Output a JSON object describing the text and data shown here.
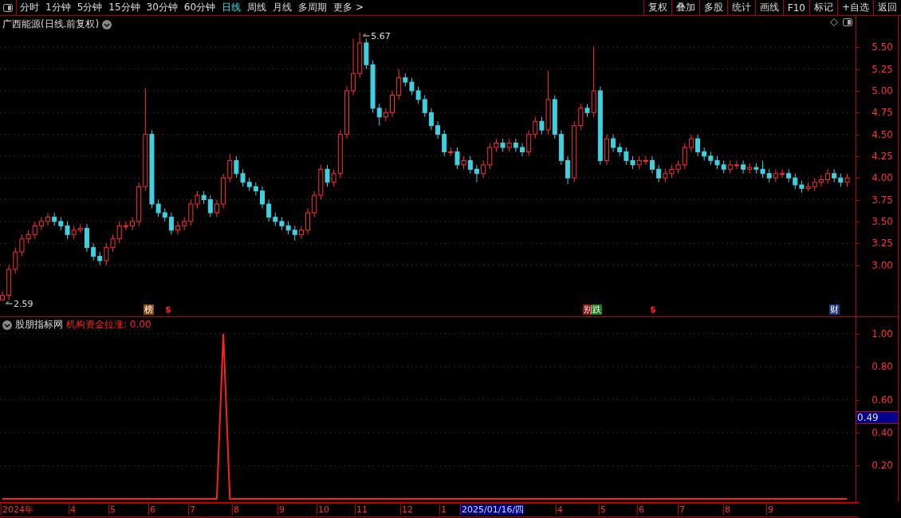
{
  "toolbar": {
    "periods": [
      {
        "label": "分时",
        "selected": false
      },
      {
        "label": "1分钟",
        "selected": false
      },
      {
        "label": "5分钟",
        "selected": false
      },
      {
        "label": "15分钟",
        "selected": false
      },
      {
        "label": "30分钟",
        "selected": false
      },
      {
        "label": "60分钟",
        "selected": false
      },
      {
        "label": "日线",
        "selected": true
      },
      {
        "label": "周线",
        "selected": false
      },
      {
        "label": "月线",
        "selected": false
      },
      {
        "label": "多周期",
        "selected": false
      },
      {
        "label": "更多 >",
        "selected": false
      }
    ],
    "buttons": [
      "复权",
      "叠加",
      "多股",
      "统计",
      "画线",
      "F10",
      "标记",
      "+自选",
      "返回"
    ]
  },
  "price_chart": {
    "title": "广西能源(日线.前复权)",
    "high_label": "5.67",
    "low_label": "2.59",
    "markers": [
      {
        "text": "榜",
        "color": "#8a4a10"
      },
      {
        "text": "$",
        "color": "#000000"
      },
      {
        "text": "别",
        "color": "#8b1010"
      },
      {
        "text": "跌",
        "color": "#1a7a1a"
      },
      {
        "text": "$",
        "color": "#000000"
      },
      {
        "text": "财",
        "color": "#1a3a7a"
      }
    ],
    "chart_data": {
      "type": "candlestick",
      "grid": true,
      "ylim": [
        2.41,
        5.86
      ],
      "yticks": [
        {
          "value": 5.5,
          "label": "5.50"
        },
        {
          "value": 5.25,
          "label": "5.25"
        },
        {
          "value": 5.0,
          "label": "5.00"
        },
        {
          "value": 4.75,
          "label": "4.75"
        },
        {
          "value": 4.5,
          "label": "4.50"
        },
        {
          "value": 4.25,
          "label": "4.25"
        },
        {
          "value": 4.0,
          "label": "4.00"
        },
        {
          "value": 3.75,
          "label": "3.75"
        },
        {
          "value": 3.5,
          "label": "3.50"
        },
        {
          "value": 3.25,
          "label": "3.25"
        },
        {
          "value": 3.0,
          "label": "3.00"
        }
      ],
      "ohlc": [
        [
          2.6,
          2.7,
          2.59,
          2.65
        ],
        [
          2.65,
          3.0,
          2.6,
          2.95
        ],
        [
          2.95,
          3.2,
          2.9,
          3.15
        ],
        [
          3.15,
          3.35,
          3.1,
          3.3
        ],
        [
          3.3,
          3.4,
          3.25,
          3.35
        ],
        [
          3.35,
          3.5,
          3.3,
          3.45
        ],
        [
          3.45,
          3.55,
          3.4,
          3.5
        ],
        [
          3.5,
          3.6,
          3.45,
          3.55
        ],
        [
          3.55,
          3.6,
          3.45,
          3.5
        ],
        [
          3.5,
          3.55,
          3.4,
          3.45
        ],
        [
          3.45,
          3.5,
          3.3,
          3.35
        ],
        [
          3.35,
          3.45,
          3.3,
          3.4
        ],
        [
          3.4,
          3.47,
          3.37,
          3.42
        ],
        [
          3.42,
          3.47,
          3.15,
          3.2
        ],
        [
          3.2,
          3.25,
          3.05,
          3.1
        ],
        [
          3.1,
          3.15,
          3.0,
          3.05
        ],
        [
          3.05,
          3.25,
          3.0,
          3.2
        ],
        [
          3.2,
          3.35,
          3.15,
          3.3
        ],
        [
          3.3,
          3.5,
          3.25,
          3.45
        ],
        [
          3.45,
          3.5,
          3.4,
          3.45
        ],
        [
          3.45,
          3.55,
          3.4,
          3.5
        ],
        [
          3.5,
          3.95,
          3.45,
          3.9
        ],
        [
          3.9,
          5.03,
          3.85,
          4.5
        ],
        [
          4.5,
          4.55,
          3.65,
          3.7
        ],
        [
          3.7,
          3.75,
          3.55,
          3.6
        ],
        [
          3.6,
          3.65,
          3.5,
          3.55
        ],
        [
          3.55,
          3.6,
          3.35,
          3.4
        ],
        [
          3.4,
          3.5,
          3.35,
          3.45
        ],
        [
          3.45,
          3.55,
          3.4,
          3.5
        ],
        [
          3.5,
          3.75,
          3.45,
          3.7
        ],
        [
          3.7,
          3.85,
          3.65,
          3.8
        ],
        [
          3.8,
          3.85,
          3.7,
          3.75
        ],
        [
          3.75,
          3.8,
          3.55,
          3.6
        ],
        [
          3.6,
          3.75,
          3.55,
          3.7
        ],
        [
          3.7,
          4.05,
          3.65,
          4.0
        ],
        [
          4.0,
          4.28,
          3.95,
          4.2
        ],
        [
          4.2,
          4.25,
          4.0,
          4.05
        ],
        [
          4.05,
          4.1,
          3.9,
          3.95
        ],
        [
          3.95,
          4.0,
          3.85,
          3.9
        ],
        [
          3.9,
          3.95,
          3.8,
          3.85
        ],
        [
          3.85,
          3.9,
          3.65,
          3.7
        ],
        [
          3.7,
          3.75,
          3.5,
          3.55
        ],
        [
          3.55,
          3.6,
          3.45,
          3.5
        ],
        [
          3.5,
          3.55,
          3.4,
          3.45
        ],
        [
          3.45,
          3.5,
          3.35,
          3.4
        ],
        [
          3.4,
          3.45,
          3.28,
          3.35
        ],
        [
          3.35,
          3.45,
          3.3,
          3.4
        ],
        [
          3.4,
          3.65,
          3.35,
          3.6
        ],
        [
          3.6,
          3.85,
          3.55,
          3.8
        ],
        [
          3.8,
          4.15,
          3.75,
          4.1
        ],
        [
          4.1,
          4.15,
          3.9,
          3.95
        ],
        [
          3.95,
          4.1,
          3.9,
          4.05
        ],
        [
          4.05,
          4.55,
          4.0,
          4.5
        ],
        [
          4.5,
          5.05,
          4.45,
          5.0
        ],
        [
          5.0,
          5.6,
          4.95,
          5.2
        ],
        [
          5.2,
          5.67,
          5.15,
          5.55
        ],
        [
          5.55,
          5.6,
          5.25,
          5.3
        ],
        [
          5.3,
          5.35,
          4.75,
          4.8
        ],
        [
          4.8,
          4.85,
          4.6,
          4.7
        ],
        [
          4.7,
          4.8,
          4.65,
          4.75
        ],
        [
          4.75,
          5.0,
          4.7,
          4.95
        ],
        [
          4.95,
          5.25,
          4.9,
          5.15
        ],
        [
          5.15,
          5.2,
          5.05,
          5.1
        ],
        [
          5.1,
          5.15,
          4.95,
          5.0
        ],
        [
          5.0,
          5.05,
          4.85,
          4.9
        ],
        [
          4.9,
          4.95,
          4.7,
          4.75
        ],
        [
          4.75,
          4.8,
          4.55,
          4.6
        ],
        [
          4.6,
          4.65,
          4.45,
          4.5
        ],
        [
          4.5,
          4.55,
          4.25,
          4.3
        ],
        [
          4.3,
          4.35,
          4.25,
          4.3
        ],
        [
          4.3,
          4.35,
          4.1,
          4.15
        ],
        [
          4.15,
          4.25,
          4.1,
          4.2
        ],
        [
          4.2,
          4.25,
          4.05,
          4.1
        ],
        [
          4.1,
          4.15,
          3.95,
          4.05
        ],
        [
          4.05,
          4.2,
          4.0,
          4.15
        ],
        [
          4.15,
          4.4,
          4.1,
          4.35
        ],
        [
          4.35,
          4.45,
          4.3,
          4.4
        ],
        [
          4.4,
          4.45,
          4.3,
          4.35
        ],
        [
          4.35,
          4.45,
          4.3,
          4.4
        ],
        [
          4.4,
          4.45,
          4.3,
          4.35
        ],
        [
          4.35,
          4.4,
          4.25,
          4.3
        ],
        [
          4.3,
          4.55,
          4.25,
          4.5
        ],
        [
          4.5,
          4.7,
          4.45,
          4.65
        ],
        [
          4.65,
          4.7,
          4.5,
          4.55
        ],
        [
          4.55,
          5.23,
          4.5,
          4.9
        ],
        [
          4.9,
          4.95,
          4.45,
          4.5
        ],
        [
          4.5,
          4.55,
          4.15,
          4.2
        ],
        [
          4.2,
          4.25,
          3.93,
          4.0
        ],
        [
          4.0,
          4.65,
          3.95,
          4.6
        ],
        [
          4.6,
          4.85,
          4.55,
          4.8
        ],
        [
          4.8,
          4.85,
          4.7,
          4.75
        ],
        [
          4.75,
          5.51,
          4.7,
          5.0
        ],
        [
          5.0,
          5.05,
          4.15,
          4.2
        ],
        [
          4.2,
          4.5,
          4.15,
          4.45
        ],
        [
          4.45,
          4.5,
          4.3,
          4.35
        ],
        [
          4.35,
          4.4,
          4.25,
          4.3
        ],
        [
          4.3,
          4.35,
          4.15,
          4.2
        ],
        [
          4.2,
          4.25,
          4.1,
          4.15
        ],
        [
          4.15,
          4.25,
          4.1,
          4.2
        ],
        [
          4.2,
          4.25,
          4.15,
          4.2
        ],
        [
          4.2,
          4.25,
          4.05,
          4.1
        ],
        [
          4.1,
          4.15,
          3.95,
          4.0
        ],
        [
          4.0,
          4.1,
          3.95,
          4.05
        ],
        [
          4.05,
          4.15,
          4.0,
          4.1
        ],
        [
          4.1,
          4.2,
          4.05,
          4.15
        ],
        [
          4.15,
          4.4,
          4.1,
          4.35
        ],
        [
          4.35,
          4.5,
          4.3,
          4.45
        ],
        [
          4.45,
          4.5,
          4.25,
          4.3
        ],
        [
          4.3,
          4.35,
          4.2,
          4.25
        ],
        [
          4.25,
          4.3,
          4.15,
          4.2
        ],
        [
          4.2,
          4.25,
          4.1,
          4.15
        ],
        [
          4.15,
          4.2,
          4.05,
          4.1
        ],
        [
          4.1,
          4.2,
          4.05,
          4.15
        ],
        [
          4.15,
          4.2,
          4.1,
          4.15
        ],
        [
          4.15,
          4.2,
          4.05,
          4.1
        ],
        [
          4.1,
          4.17,
          4.05,
          4.12
        ],
        [
          4.12,
          4.17,
          4.05,
          4.1
        ],
        [
          4.1,
          4.2,
          4.0,
          4.05
        ],
        [
          4.05,
          4.1,
          3.95,
          4.0
        ],
        [
          4.0,
          4.1,
          3.95,
          4.05
        ],
        [
          4.05,
          4.1,
          4.0,
          4.05
        ],
        [
          4.05,
          4.1,
          3.95,
          4.0
        ],
        [
          4.0,
          4.05,
          3.87,
          3.92
        ],
        [
          3.92,
          3.97,
          3.83,
          3.88
        ],
        [
          3.88,
          3.95,
          3.85,
          3.9
        ],
        [
          3.9,
          4.0,
          3.85,
          3.95
        ],
        [
          3.95,
          4.03,
          3.9,
          3.98
        ],
        [
          3.98,
          4.1,
          3.93,
          4.05
        ],
        [
          4.05,
          4.1,
          3.95,
          4.0
        ],
        [
          4.0,
          4.05,
          3.9,
          3.95
        ],
        [
          3.95,
          4.05,
          3.9,
          4.0
        ]
      ]
    }
  },
  "indicator": {
    "source": "股朋指标网",
    "name": "机构资金拉涨: 0.00",
    "current_value": "0.49",
    "chart_data": {
      "type": "line",
      "grid": true,
      "ylim": [
        -0.02,
        1.1
      ],
      "yticks": [
        {
          "value": 1.0,
          "label": "1.00"
        },
        {
          "value": 0.8,
          "label": "0.80"
        },
        {
          "value": 0.6,
          "label": "0.60"
        },
        {
          "value": 0.4,
          "label": "0.40"
        },
        {
          "value": 0.2,
          "label": "0.20"
        }
      ],
      "series": [
        {
          "color": "#ff2020",
          "values": [
            0,
            0,
            0,
            0,
            0,
            0,
            0,
            0,
            0,
            0,
            0,
            0,
            0,
            0,
            0,
            0,
            0,
            0,
            0,
            0,
            0,
            0,
            0,
            0,
            0,
            0,
            0,
            0,
            0,
            0,
            0,
            0,
            0,
            0,
            1,
            0,
            0,
            0,
            0,
            0,
            0,
            0,
            0,
            0,
            0,
            0,
            0,
            0,
            0,
            0,
            0,
            0,
            0,
            0,
            0,
            0,
            0,
            0,
            0,
            0,
            0,
            0,
            0,
            0,
            0,
            0,
            0,
            0,
            0,
            0,
            0,
            0,
            0,
            0,
            0,
            0,
            0,
            0,
            0,
            0,
            0,
            0,
            0,
            0,
            0,
            0,
            0,
            0,
            0,
            0,
            0,
            0,
            0,
            0,
            0,
            0,
            0,
            0,
            0,
            0,
            0,
            0,
            0,
            0,
            0,
            0,
            0,
            0,
            0,
            0,
            0,
            0,
            0,
            0,
            0,
            0,
            0,
            0,
            0,
            0,
            0,
            0,
            0,
            0,
            0,
            0,
            0,
            0,
            0,
            0,
            0
          ]
        }
      ]
    }
  },
  "date_axis": [
    {
      "label": "2024年",
      "selected": false
    },
    {
      "label": "4",
      "selected": false
    },
    {
      "label": "5",
      "selected": false
    },
    {
      "label": "6",
      "selected": false
    },
    {
      "label": "7",
      "selected": false
    },
    {
      "label": "8",
      "selected": false
    },
    {
      "label": "9",
      "selected": false
    },
    {
      "label": "10",
      "selected": false
    },
    {
      "label": "11",
      "selected": false
    },
    {
      "label": "12",
      "selected": false
    },
    {
      "label": "1",
      "selected": false
    },
    {
      "label": "2025/01/16/四",
      "selected": true
    },
    {
      "label": "4",
      "selected": false
    },
    {
      "label": "5",
      "selected": false
    },
    {
      "label": "6",
      "selected": false
    },
    {
      "label": "7",
      "selected": false
    },
    {
      "label": "8",
      "selected": false
    },
    {
      "label": "9",
      "selected": false
    }
  ]
}
